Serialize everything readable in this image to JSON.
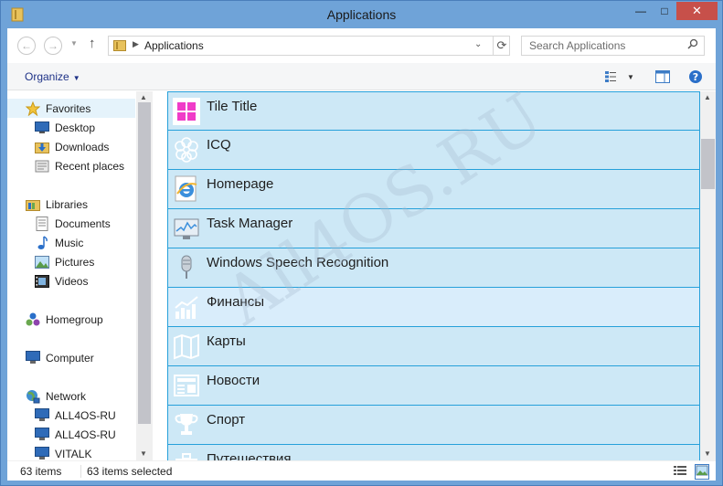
{
  "window": {
    "title": "Applications",
    "controls": {
      "minimize": "—",
      "maximize": "□",
      "close": "✕"
    }
  },
  "address_bar": {
    "path": "Applications",
    "search_placeholder": "Search Applications"
  },
  "command_bar": {
    "organize_label": "Organize"
  },
  "nav_pane": {
    "favorites": {
      "label": "Favorites",
      "items": [
        "Desktop",
        "Downloads",
        "Recent places"
      ]
    },
    "libraries": {
      "label": "Libraries",
      "items": [
        "Documents",
        "Music",
        "Pictures",
        "Videos"
      ]
    },
    "homegroup": "Homegroup",
    "computer": "Computer",
    "network": {
      "label": "Network",
      "items": [
        "ALL4OS-RU",
        "ALL4OS-RU",
        "VITALK"
      ]
    }
  },
  "items": [
    {
      "label": "Tile Title",
      "icon": "pink-grid-icon"
    },
    {
      "label": "ICQ",
      "icon": "flower-icon"
    },
    {
      "label": "Homepage",
      "icon": "ie-icon"
    },
    {
      "label": "Task Manager",
      "icon": "monitor-chart-icon"
    },
    {
      "label": "Windows Speech Recognition",
      "icon": "microphone-icon"
    },
    {
      "label": "Финансы",
      "icon": "chart-icon"
    },
    {
      "label": "Карты",
      "icon": "map-icon"
    },
    {
      "label": "Новости",
      "icon": "news-icon"
    },
    {
      "label": "Спорт",
      "icon": "trophy-icon"
    },
    {
      "label": "Путешествия",
      "icon": "suitcase-icon"
    }
  ],
  "status_bar": {
    "item_count": "63 items",
    "selected_count": "63 items selected"
  },
  "watermark": "All4OS.RU",
  "colors": {
    "title_bar": "#6fa3d8",
    "selection_fill": "#cde8f6",
    "selection_border": "#26a0da",
    "close_button": "#c7504a"
  }
}
